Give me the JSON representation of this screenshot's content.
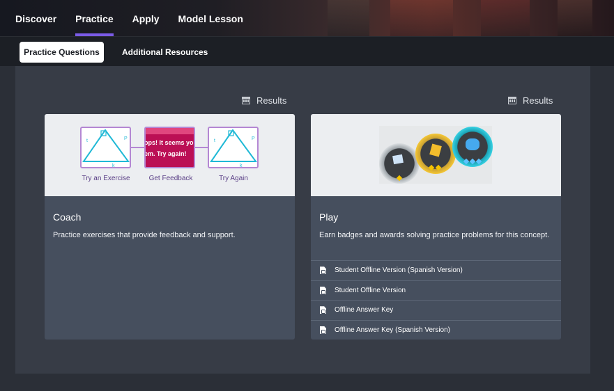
{
  "nav": {
    "items": [
      "Discover",
      "Practice",
      "Apply",
      "Model Lesson"
    ],
    "active": "Practice"
  },
  "subnav": {
    "active_label": "Practice Questions",
    "other_label": "Additional Resources"
  },
  "results_label": "Results",
  "coach": {
    "title": "Coach",
    "description": "Practice exercises that provide feedback and support.",
    "illustration": {
      "captions": [
        "Try an Exercise",
        "Get Feedback",
        "Try Again"
      ],
      "feedback_lines": [
        "ops! It seems yo",
        "em. Try again!"
      ],
      "triangle_labels": {
        "left": "t",
        "right": "P",
        "bottom": "k"
      }
    }
  },
  "play": {
    "title": "Play",
    "description": "Earn badges and awards solving practice problems for this concept.",
    "badges": [
      "SINGLE STAR",
      "DOUBLE STAR",
      "TRIPLE STAR"
    ],
    "links": [
      "Student Offline Version (Spanish Version)",
      "Student Offline Version",
      "Offline Answer Key",
      "Offline Answer Key (Spanish Version)"
    ]
  },
  "colors": {
    "accent": "#7b5be6",
    "card": "#464f5e",
    "panel": "#373c46",
    "feedback": "#bb0f55"
  }
}
